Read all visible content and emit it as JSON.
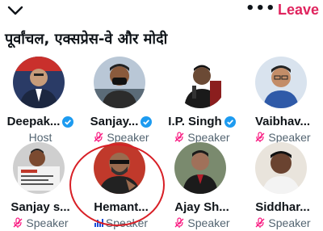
{
  "header": {
    "collapse_icon": "chevron-down-icon",
    "more_icon": "more-icon",
    "more_label": "•••",
    "leave_label": "Leave",
    "leave_color": "#e0245e"
  },
  "space": {
    "title": "पूर्वांचल, एक्सप्रेस-वे और मोदी"
  },
  "participants": [
    {
      "name": "Deepak...",
      "role": "Host",
      "verified": true,
      "mic": "none"
    },
    {
      "name": "Sanjay...",
      "role": "Speaker",
      "verified": true,
      "mic": "muted"
    },
    {
      "name": "I.P. Singh",
      "role": "Speaker",
      "verified": true,
      "mic": "muted"
    },
    {
      "name": "Vaibhav...",
      "role": "Speaker",
      "verified": false,
      "mic": "muted"
    },
    {
      "name": "Sanjay s...",
      "role": "Speaker",
      "verified": false,
      "mic": "muted"
    },
    {
      "name": "Hemant...",
      "role": "Speaker",
      "verified": false,
      "mic": "speaking"
    },
    {
      "name": "Ajay Sh...",
      "role": "Speaker",
      "verified": false,
      "mic": "muted"
    },
    {
      "name": "Siddhar...",
      "role": "Speaker",
      "verified": false,
      "mic": "muted"
    }
  ],
  "colors": {
    "verified": "#1d9bf0",
    "muted_mic": "#f91880",
    "speaking": "#1d4ed8",
    "annotation_circle": "#d81f26"
  }
}
